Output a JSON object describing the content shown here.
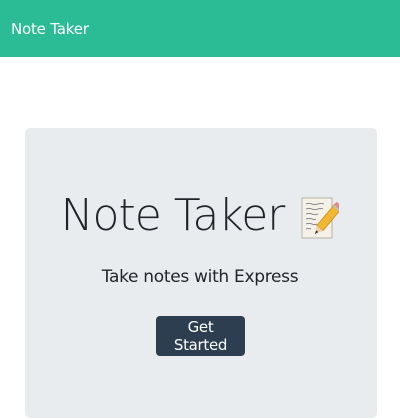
{
  "navbar": {
    "brand": "Note Taker",
    "background": "#2bbb95"
  },
  "hero": {
    "title": "Note Taker",
    "title_icon": "memo-pencil-icon",
    "subtitle": "Take notes with Express",
    "background": "#e9ecef"
  },
  "cta": {
    "label": "Get Started",
    "background": "#2c3e50"
  }
}
